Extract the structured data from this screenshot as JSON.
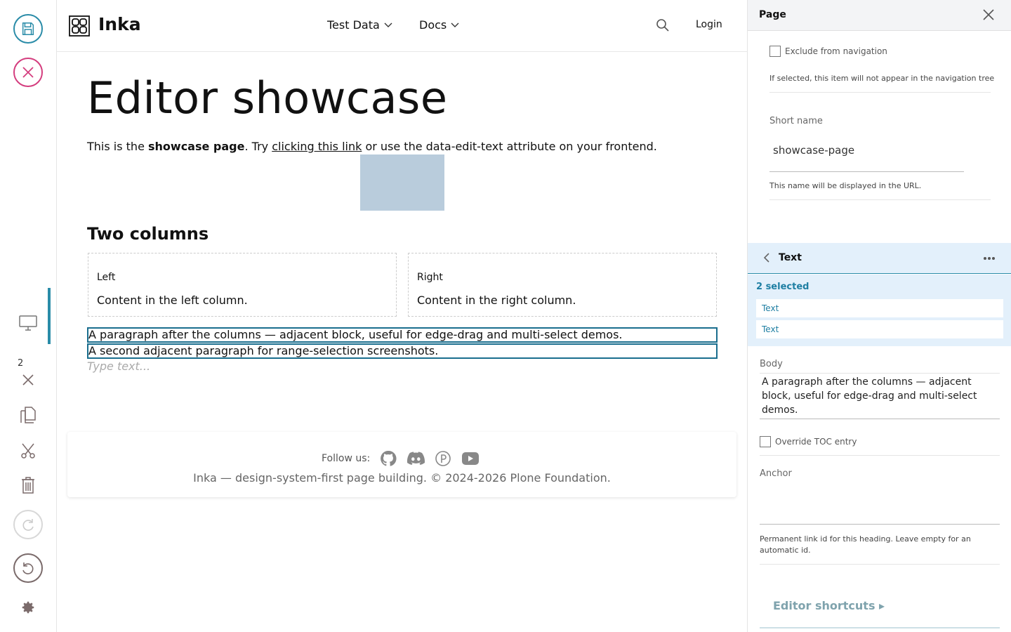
{
  "header": {
    "brand": "Inka",
    "nav": [
      {
        "label": "Test Data"
      },
      {
        "label": "Docs"
      }
    ],
    "login_label": "Login"
  },
  "toolbar": {
    "selection_count": "2"
  },
  "main": {
    "title": "Editor showcase",
    "intro": {
      "pre": "This is the ",
      "bold": "showcase page",
      "mid": ". Try ",
      "link": "clicking this link",
      "post": " or use the data-edit-text attribute on your frontend."
    },
    "section_heading": "Two columns",
    "columns": [
      {
        "label": "Left",
        "text": "Content in the left column."
      },
      {
        "label": "Right",
        "text": "Content in the right column."
      }
    ],
    "paragraphs": [
      "A paragraph after the columns — adjacent block, useful for edge-drag and multi-select demos.",
      "A second adjacent paragraph for range-selection screenshots."
    ],
    "placeholder": "Type text..."
  },
  "footer": {
    "follow_label": "Follow us:",
    "copyright": "Inka — design-system-first page building. © 2024-2026 Plone Foundation."
  },
  "sidebar": {
    "title": "Page",
    "exclude_label": "Exclude from navigation",
    "exclude_help": "If selected, this item will not appear in the navigation tree",
    "short_name_label": "Short name",
    "short_name_value": "showcase-page",
    "short_name_help": "This name will be displayed in the URL.",
    "block": {
      "title": "Text",
      "selected_count": "2 selected",
      "selected_items": [
        "Text",
        "Text"
      ],
      "body_label": "Body",
      "body_value": "A paragraph after the columns — adjacent block, useful for edge-drag and multi-select demos.",
      "override_toc_label": "Override TOC entry",
      "anchor_label": "Anchor",
      "anchor_help": "Permanent link id for this heading. Leave empty for an automatic id."
    },
    "shortcuts_label": "Editor shortcuts ▸"
  },
  "colors": {
    "accent": "#2a8ca8",
    "danger": "#d43d7e",
    "selection_bg": "#e3f0fb",
    "image_placeholder": "#b9ccdc"
  }
}
